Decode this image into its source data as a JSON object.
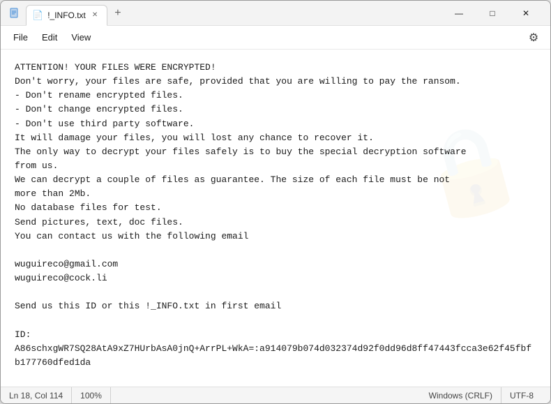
{
  "window": {
    "title": "!_INFO.txt",
    "tab_label": "!_INFO.txt"
  },
  "titlebar": {
    "minimize_label": "—",
    "maximize_label": "□",
    "close_label": "✕",
    "add_tab_label": "+",
    "tab_close_label": "✕"
  },
  "menubar": {
    "file_label": "File",
    "edit_label": "Edit",
    "view_label": "View",
    "gear_icon": "⚙"
  },
  "content": {
    "text": "ATTENTION! YOUR FILES WERE ENCRYPTED!\nDon't worry, your files are safe, provided that you are willing to pay the ransom.\n- Don't rename encrypted files.\n- Don't change encrypted files.\n- Don't use third party software.\nIt will damage your files, you will lost any chance to recover it.\nThe only way to decrypt your files safely is to buy the special decryption software\nfrom us.\nWe can decrypt a couple of files as guarantee. The size of each file must be not\nmore than 2Mb.\nNo database files for test.\nSend pictures, text, doc files.\nYou can contact us with the following email\n\nwuguireco@gmail.com\nwuguireco@cock.li\n\nSend us this ID or this !_INFO.txt in first email\n\nID:\nA86schxgWR7SQ28AtA9xZ7HUrbAsA0jnQ+ArrPL+WkA=:a914079b074d032374d92f0dd96d8ff47443fcca3e62f45fbfb177760dfed1da"
  },
  "statusbar": {
    "position": "Ln 18, Col 114",
    "zoom": "100%",
    "line_ending": "Windows (CRLF)",
    "encoding": "UTF-8"
  }
}
